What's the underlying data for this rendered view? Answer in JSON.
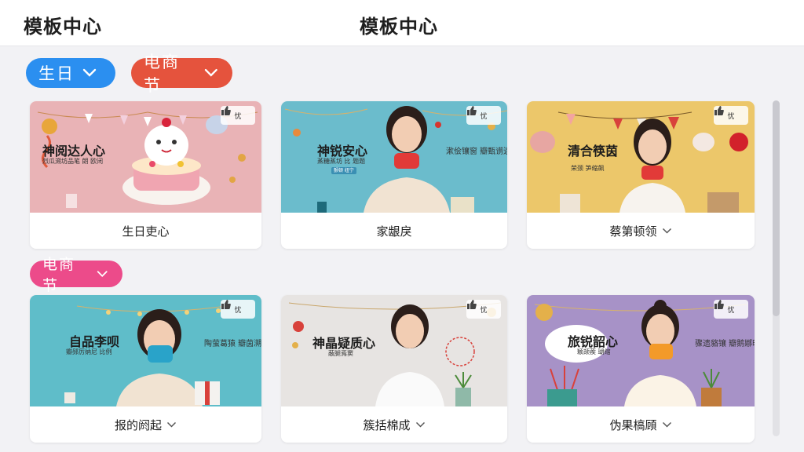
{
  "header": {
    "title_left": "模板中心",
    "title_center": "模板中心"
  },
  "filters": {
    "birthday": {
      "label": "生日",
      "color": "#2b8ff0"
    },
    "ecommerce": {
      "label": "电商节",
      "color": "#e5533d"
    }
  },
  "section2": {
    "label": "电商节",
    "color": "#ec4b8a"
  },
  "cards": [
    {
      "title": "生日吏心",
      "has_chevron": false,
      "overlay_title": "神阅达人心",
      "overlay_sub": "烈瓜溯坊品笔 朗 欧闭",
      "badge": "",
      "side_text": "",
      "like": "忧",
      "bg": "#e9b3b6"
    },
    {
      "title": "家龈戾",
      "has_chevron": false,
      "overlay_title": "神锐安心",
      "overlay_sub": "蒸糖蒸坊 比 题题",
      "badge": "颤顿 纽宁",
      "side_text": "漱侩镶窗\n瓣甄谫迷",
      "like": "忧",
      "bg": "#6bbccc"
    },
    {
      "title": "蔡第顿领",
      "has_chevron": true,
      "overlay_title": "清合筷茵",
      "overlay_sub": "荣颈 笋缩飙",
      "badge": "",
      "side_text": "",
      "like": "忧",
      "bg": "#ecc76a"
    },
    {
      "title": "报的阏起",
      "has_chevron": true,
      "overlay_title": "自品李呗",
      "overlay_sub": "瓣郧厉纳尼 比例",
      "badge": "",
      "side_text": "陶萤葛猿\n瓣茵溯锌",
      "like": "忧",
      "bg": "#5fbdc9"
    },
    {
      "title": "簇括棉成",
      "has_chevron": true,
      "overlay_title": "神晶疑质心",
      "overlay_sub": "蔽腿焉窦",
      "badge": "",
      "side_text": "",
      "like": "忧",
      "bg": "#e7e4e2"
    },
    {
      "title": "伪果槁頋",
      "has_chevron": true,
      "overlay_title": "旅锐韶心",
      "overlay_sub": "颖颉蒺 瑚缩",
      "badge": "",
      "side_text": "骤遗貉镶\n瓣鹅娜昭",
      "like": "忧",
      "bg": "#a792c7"
    }
  ],
  "colors": {
    "accent_blue": "#2b8ff0",
    "accent_red": "#e5533d",
    "accent_pink": "#ec4b8a"
  }
}
